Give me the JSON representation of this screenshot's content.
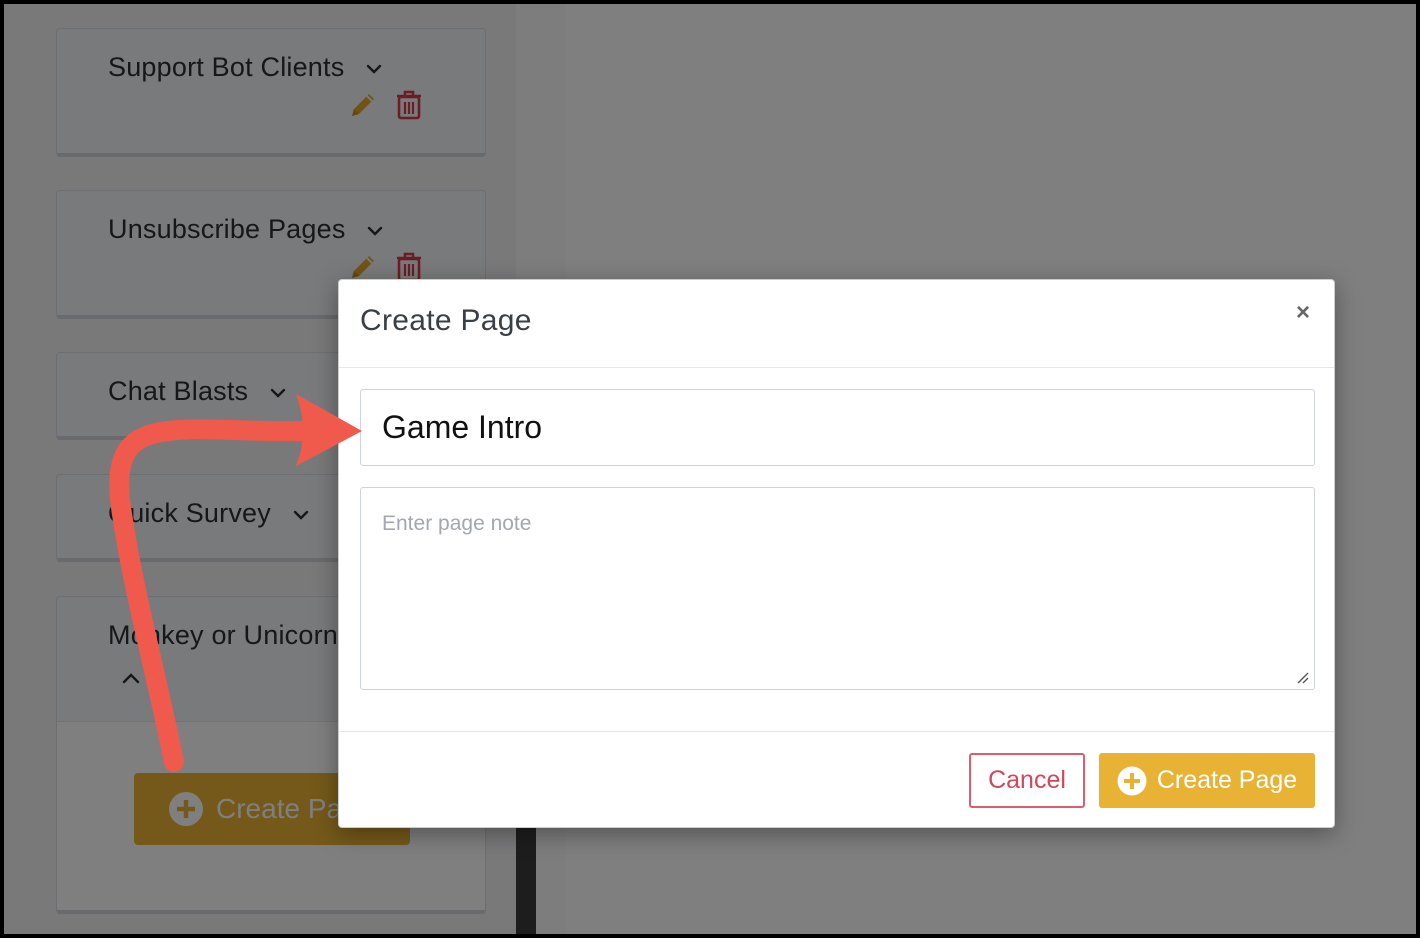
{
  "sidebar": {
    "categories": [
      {
        "title": "Support Bot Clients"
      },
      {
        "title": "Unsubscribe Pages"
      },
      {
        "title": "Chat Blasts"
      },
      {
        "title": "Quick Survey"
      },
      {
        "title": "Monkey or Unicorn"
      }
    ],
    "create_page_label": "Create Page"
  },
  "modal": {
    "title": "Create Page",
    "close_label": "×",
    "page_name_value": "Game Intro",
    "page_note_placeholder": "Enter page note",
    "cancel_label": "Cancel",
    "create_label": "Create Page"
  },
  "colors": {
    "accent": "#e8b235",
    "danger": "#d5465b",
    "arrow": "#f2594c"
  },
  "icons": [
    "chevron-down-icon",
    "chevron-up-icon",
    "pencil-icon",
    "trash-icon",
    "plus-circle-icon",
    "close-icon",
    "resize-grip-icon"
  ]
}
